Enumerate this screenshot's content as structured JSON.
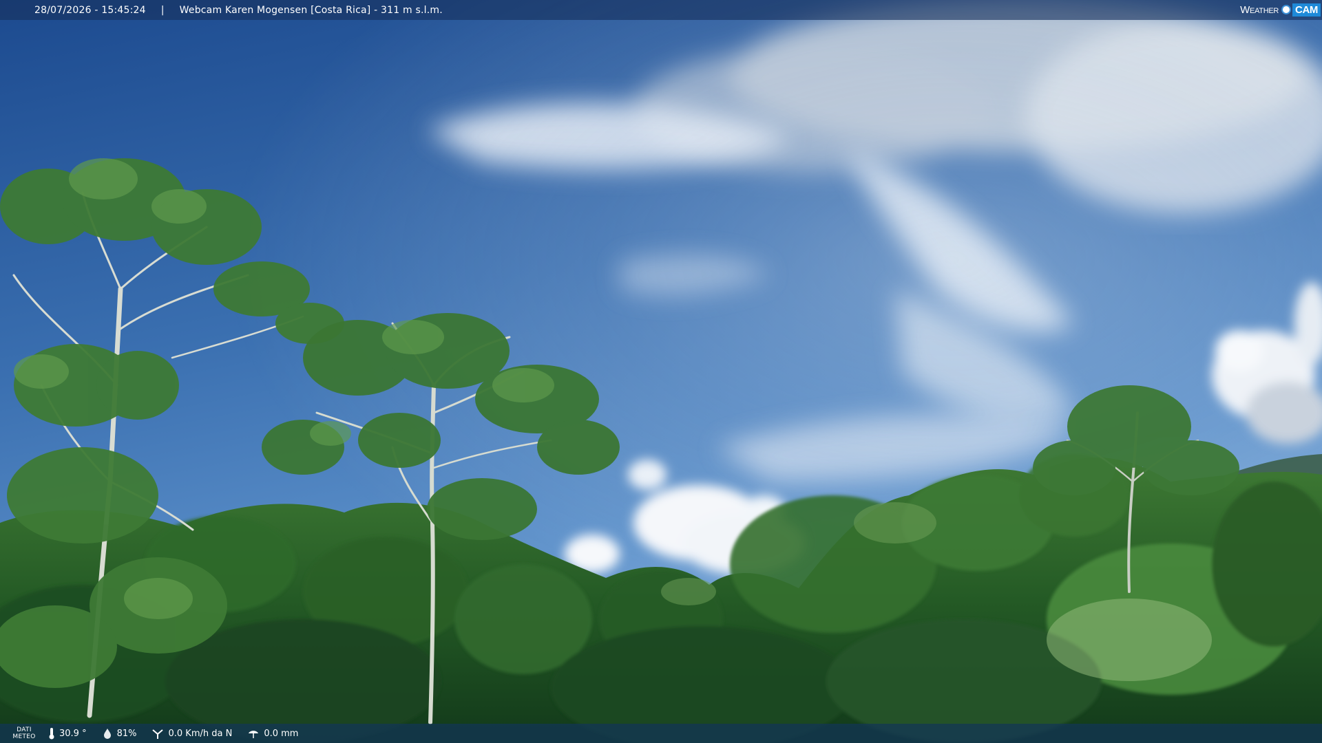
{
  "top_bar": {
    "timestamp": "28/07/2026 - 15:45:24",
    "separator": "|",
    "title": "Webcam Karen Mogensen [Costa Rica] - 311 m s.l.m."
  },
  "logo": {
    "weather": "Weather",
    "cam": "CAM"
  },
  "bottom_bar": {
    "label_line1": "DATI",
    "label_line2": "METEO",
    "temperature": "30.9 °",
    "humidity": "81%",
    "wind": "0.0 Km/h da N",
    "rain": "0.0 mm"
  },
  "colors": {
    "sky_top": "#1f4f93",
    "sky_bottom": "#7aa6d6",
    "foliage_dark": "#17401c",
    "foliage_light": "#4f8a3a",
    "bar_bg": "#16305c"
  },
  "icons": {
    "temperature": "thermometer-icon",
    "humidity": "humidity-drop-icon",
    "wind": "wind-vane-icon",
    "rain": "rain-gauge-icon"
  }
}
